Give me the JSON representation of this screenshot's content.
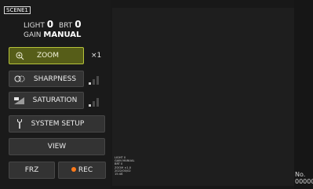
{
  "status": {
    "scene": "SCENE1",
    "light_label": "LIGHT",
    "light_value": "0",
    "brt_label": "BRT",
    "brt_value": "0",
    "gain_label": "GAIN",
    "gain_value": "MANUAL"
  },
  "buttons": {
    "zoom": "ZOOM",
    "zoom_level": "×1",
    "sharpness": "SHARPNESS",
    "saturation": "SATURATION",
    "system_setup": "SYSTEM SETUP",
    "view": "VIEW",
    "freeze": "FRZ",
    "record": "REC"
  },
  "levels": {
    "sharpness": 0.25,
    "saturation": 0.25
  },
  "overlay": {
    "lines": [
      "LIGHT 0",
      "GAIN MANUAL",
      "BRT 0",
      "ZOOM ×1.0",
      "2022/00/02",
      "15:46"
    ]
  },
  "number": {
    "label": "No.",
    "value": "00000"
  },
  "colors": {
    "zoom_active_fill": "#565d18",
    "zoom_active_border": "#b7c43a",
    "record_dot": "#ff7a1a"
  },
  "icons": {
    "zoom": "magnifier-plus-icon",
    "sharpness": "sharpness-icon",
    "saturation": "saturation-icon",
    "system_setup": "wrench-icon",
    "record": "record-dot-icon"
  }
}
